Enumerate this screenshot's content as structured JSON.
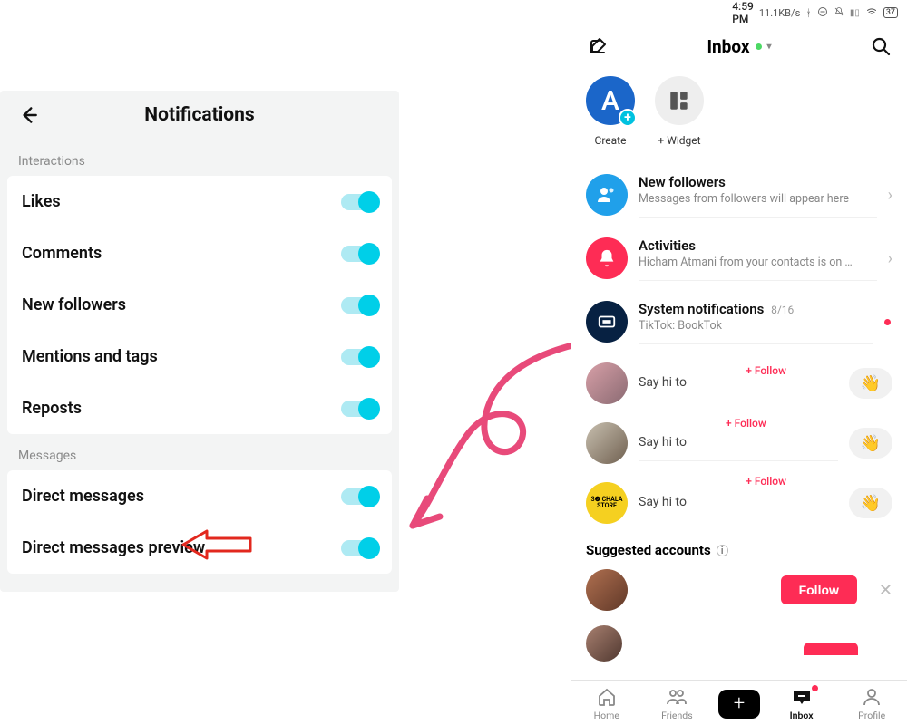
{
  "left": {
    "title": "Notifications",
    "sections": [
      {
        "label": "Interactions",
        "items": [
          {
            "label": "Likes",
            "on": true
          },
          {
            "label": "Comments",
            "on": true
          },
          {
            "label": "New followers",
            "on": true
          },
          {
            "label": "Mentions and tags",
            "on": true
          },
          {
            "label": "Reposts",
            "on": true
          }
        ]
      },
      {
        "label": "Messages",
        "items": [
          {
            "label": "Direct messages",
            "on": true
          },
          {
            "label": "Direct messages preview",
            "on": true
          }
        ]
      }
    ]
  },
  "right": {
    "status": {
      "time": "4:59 PM",
      "rate": "11.1KB/s",
      "battery": "37"
    },
    "title": "Inbox",
    "quick": {
      "create": {
        "letter": "A",
        "label": "Create"
      },
      "widget": {
        "label": "+ Widget"
      }
    },
    "rows": {
      "followers": {
        "title": "New followers",
        "sub": "Messages from followers will appear here"
      },
      "activities": {
        "title": "Activities",
        "sub": "Hicham Atmani from your contacts is on …"
      },
      "system": {
        "title": "System notifications",
        "date": "8/16",
        "sub": "TikTok: BookTok"
      }
    },
    "sayhi": "Say hi to",
    "followInline": "+ Follow",
    "wave": "👋",
    "suggested": "Suggested accounts",
    "followBtn": "Follow",
    "tabs": {
      "home": "Home",
      "friends": "Friends",
      "inbox": "Inbox",
      "profile": "Profile"
    }
  }
}
